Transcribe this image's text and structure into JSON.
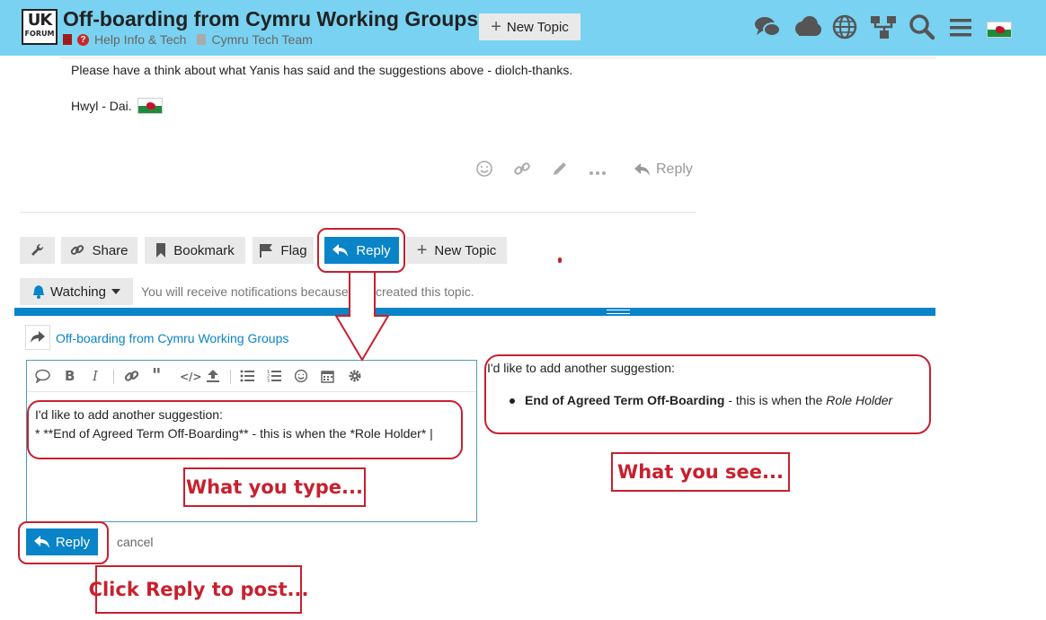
{
  "header": {
    "logo_line1": "UK",
    "logo_line2": "FORUM",
    "title": "Off-boarding from Cymru Working Groups",
    "category_parent": "Help Info & Tech",
    "category_child": "Cymru Tech Team",
    "new_topic_label": "New Topic",
    "icons": [
      "chat-bubbles-icon",
      "cloud-icon",
      "globe-icon",
      "sitemap-icon",
      "search-icon",
      "hamburger-menu-icon",
      "welsh-flag-icon"
    ]
  },
  "post": {
    "line1": "Please have a think about what Yanis has said and the suggestions above - diolch-thanks.",
    "line2": "Hwyl - Dai.",
    "reply_label": "Reply"
  },
  "topic_footer": {
    "share_label": "Share",
    "bookmark_label": "Bookmark",
    "flag_label": "Flag",
    "reply_label": "Reply",
    "new_topic_label": "New Topic",
    "watching_label": "Watching",
    "notification_text": "You will receive notifications because you created this topic."
  },
  "composer": {
    "reply_to_title": "Off-boarding from Cymru Working Groups",
    "editor_line1": "I'd like to add another suggestion:",
    "editor_line2": "* **End of Agreed Term Off-Boarding** - this is when the *Role Holder* |",
    "preview_line1": "I'd like to add another suggestion:",
    "preview_bold": "End of Agreed Term Off-Boarding",
    "preview_mid": " - this is when the ",
    "preview_italic": "Role Holder",
    "submit_label": "Reply",
    "cancel_label": "cancel"
  },
  "annotations": {
    "what_you_type": "What you type...",
    "what_you_see": "What you see...",
    "click_reply": "Click Reply to post..."
  },
  "colors": {
    "header_bg": "#79d2f1",
    "primary": "#0a84c8",
    "annotation_red": "#c8202e"
  }
}
